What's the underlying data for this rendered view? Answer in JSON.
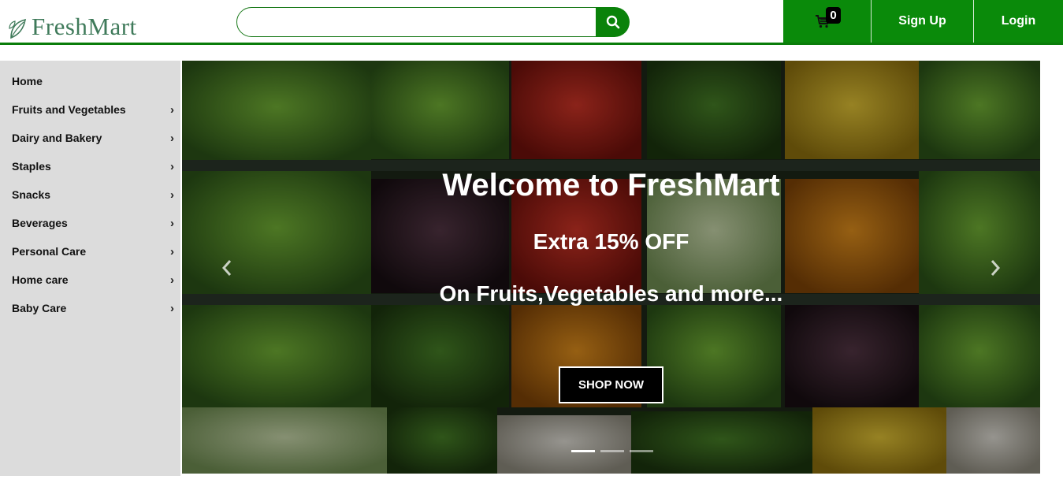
{
  "header": {
    "brand": "FreshMart",
    "search": {
      "placeholder": "",
      "value": ""
    },
    "cart_count": "0",
    "signup_label": "Sign Up",
    "login_label": "Login",
    "accent_color": "#0a8a0a"
  },
  "sidebar": {
    "items": [
      {
        "label": "Home",
        "has_submenu": false
      },
      {
        "label": "Fruits and Vegetables",
        "has_submenu": true
      },
      {
        "label": "Dairy and Bakery",
        "has_submenu": true
      },
      {
        "label": "Staples",
        "has_submenu": true
      },
      {
        "label": "Snacks",
        "has_submenu": true
      },
      {
        "label": "Beverages",
        "has_submenu": true
      },
      {
        "label": "Personal Care",
        "has_submenu": true
      },
      {
        "label": "Home care",
        "has_submenu": true
      },
      {
        "label": "Baby Care",
        "has_submenu": true
      }
    ]
  },
  "hero": {
    "title": "Welcome to FreshMart",
    "subtitle1": "Extra 15% OFF",
    "subtitle2": "On Fruits,Vegetables and more...",
    "cta": "SHOP NOW",
    "slides": 3,
    "active_slide": 1
  },
  "icons": {
    "search": "search-icon",
    "cart": "cart-icon",
    "prev": "chevron-left-icon",
    "next": "chevron-right-icon",
    "submenu": "chevron-right-icon"
  }
}
